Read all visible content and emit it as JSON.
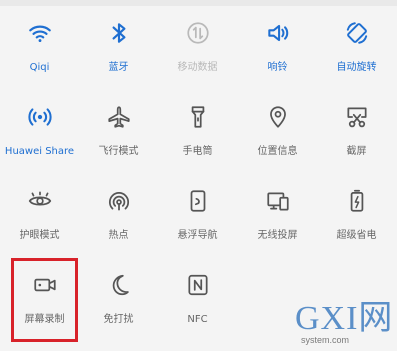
{
  "quick_settings": {
    "tiles": [
      {
        "label": "Qiqi",
        "icon": "wifi-icon",
        "state": "active"
      },
      {
        "label": "蓝牙",
        "icon": "bluetooth-icon",
        "state": "active"
      },
      {
        "label": "移动数据",
        "icon": "mobile-data-icon",
        "state": "disabled"
      },
      {
        "label": "响铃",
        "icon": "sound-icon",
        "state": "active"
      },
      {
        "label": "自动旋转",
        "icon": "auto-rotate-icon",
        "state": "active"
      },
      {
        "label": "Huawei Share",
        "icon": "huawei-share-icon",
        "state": "active"
      },
      {
        "label": "飞行模式",
        "icon": "airplane-mode-icon",
        "state": "inactive"
      },
      {
        "label": "手电筒",
        "icon": "flashlight-icon",
        "state": "inactive"
      },
      {
        "label": "位置信息",
        "icon": "location-icon",
        "state": "inactive"
      },
      {
        "label": "截屏",
        "icon": "screenshot-icon",
        "state": "inactive"
      },
      {
        "label": "护眼模式",
        "icon": "eye-comfort-icon",
        "state": "inactive"
      },
      {
        "label": "热点",
        "icon": "hotspot-icon",
        "state": "inactive"
      },
      {
        "label": "悬浮导航",
        "icon": "floating-nav-icon",
        "state": "inactive"
      },
      {
        "label": "无线投屏",
        "icon": "wireless-projection-icon",
        "state": "inactive"
      },
      {
        "label": "超级省电",
        "icon": "ultra-power-saving-icon",
        "state": "inactive"
      },
      {
        "label": "屏幕录制",
        "icon": "screen-record-icon",
        "state": "inactive"
      },
      {
        "label": "免打扰",
        "icon": "do-not-disturb-icon",
        "state": "inactive"
      },
      {
        "label": "NFC",
        "icon": "nfc-icon",
        "state": "inactive"
      }
    ]
  },
  "highlight": {
    "target_label": "屏幕录制",
    "color": "#d8222a"
  },
  "watermark": {
    "brand": "GXI网",
    "domain": "system.com"
  },
  "colors": {
    "active": "#1f6fd1",
    "inactive": "#666666",
    "disabled": "#b9b9b9",
    "background": "#f4f4f4"
  }
}
